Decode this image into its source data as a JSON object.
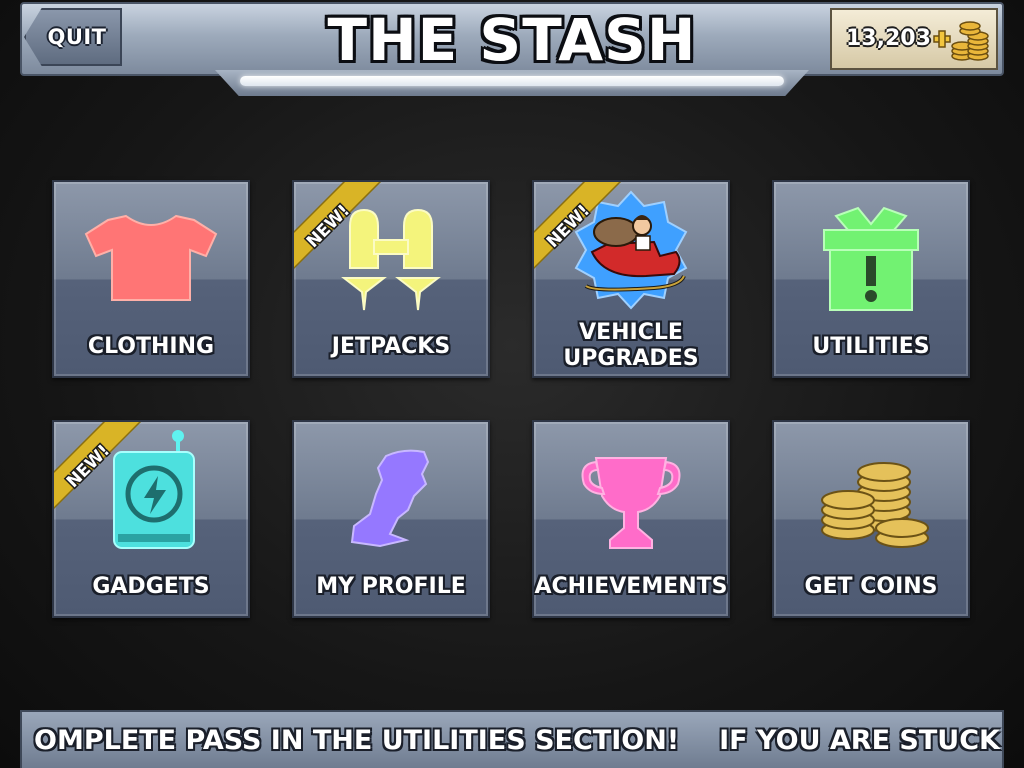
{
  "header": {
    "quit_label": "QUIT",
    "title": "THE STASH",
    "coins": "13,203"
  },
  "tiles": [
    {
      "label": "CLOTHING",
      "icon": "t-shirt-icon",
      "color": "#ff6f6f",
      "new": false
    },
    {
      "label": "JETPACKS",
      "icon": "jetpack-icon",
      "color": "#f2f27a",
      "new": true
    },
    {
      "label_line1": "VEHICLE",
      "label_line2": "UPGRADES",
      "icon": "sleigh-vehicle-icon",
      "color": "#4aa6ff",
      "new": true
    },
    {
      "label": "UTILITIES",
      "icon": "gift-box-icon",
      "color": "#6fff6f",
      "new": false
    },
    {
      "label": "GADGETS",
      "icon": "gadget-device-icon",
      "color": "#5ff2f0",
      "new": true
    },
    {
      "label": "MY PROFILE",
      "icon": "profile-silhouette-icon",
      "color": "#9a7dff",
      "new": false
    },
    {
      "label": "ACHIEVEMENTS",
      "icon": "trophy-icon",
      "color": "#ff66c8",
      "new": false
    },
    {
      "label": "GET COINS",
      "icon": "coin-stacks-icon",
      "color": "#e5c15a",
      "new": false
    }
  ],
  "badge": {
    "text": "NEW!",
    "color": "#d9b426"
  },
  "ticker": {
    "segment1": "OMPLETE PASS IN THE UTILITIES SECTION!",
    "segment2": "IF YOU ARE STUCK ON A MISSION, YOU C"
  }
}
